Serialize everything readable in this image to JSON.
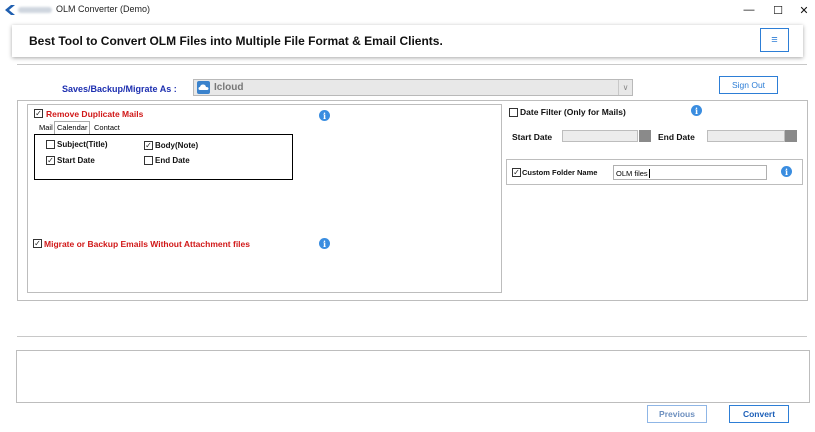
{
  "window": {
    "title": "OLM Converter (Demo)",
    "minimize": "—",
    "maximize": "☐",
    "close": "✕"
  },
  "header": {
    "title": "Best Tool to Convert OLM Files into Multiple File Format & Email Clients.",
    "menu_icon": "≡"
  },
  "saves": {
    "label": "Saves/Backup/Migrate As :",
    "selected": "Icloud",
    "arrow": "∨"
  },
  "sign_out_label": "Sign Out",
  "left_panel": {
    "remove_duplicates": {
      "label": "Remove Duplicate Mails",
      "checked": true
    },
    "tabs": [
      "Mail",
      "Calendar",
      "Contact"
    ],
    "active_tab": "Calendar",
    "options": [
      {
        "label": "Subject(Title)",
        "checked": false
      },
      {
        "label": "Body(Note)",
        "checked": true
      },
      {
        "label": "Start Date",
        "checked": true
      },
      {
        "label": "End Date",
        "checked": false
      }
    ],
    "migrate_without_attachment": {
      "label": "Migrate or Backup Emails Without Attachment files",
      "checked": true
    }
  },
  "right_panel": {
    "date_filter": {
      "label": "Date Filter  (Only for Mails)",
      "checked": false
    },
    "start_date_label": "Start Date",
    "end_date_label": "End Date",
    "custom_folder": {
      "label": "Custom Folder Name",
      "checked": true,
      "value": "OLM files"
    }
  },
  "info_glyph": "i",
  "check_glyph": "✓",
  "footer": {
    "previous_label": "Previous",
    "convert_label": "Convert"
  },
  "colors": {
    "accent": "#2d7ed6",
    "saves_label": "#1d2fb0",
    "red_label": "#d11818",
    "info": "#3a8de0"
  }
}
